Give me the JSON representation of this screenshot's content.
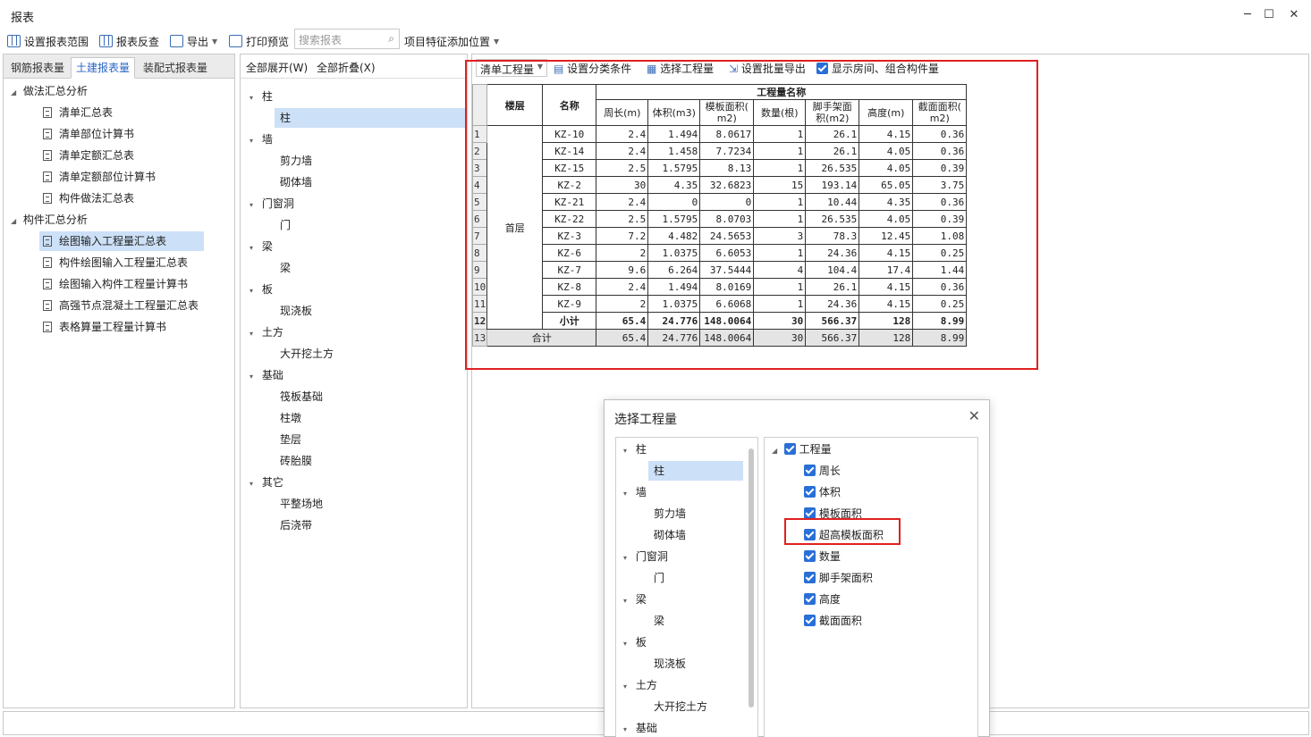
{
  "window": {
    "title": "报表",
    "controls": [
      "─",
      "☐",
      "✕"
    ]
  },
  "toolbar": {
    "set_range": "设置报表范围",
    "reverse": "报表反查",
    "export": "导出",
    "print_preview": "打印预览",
    "search_placeholder": "搜索报表",
    "add_position": "项目特征添加位置"
  },
  "left_tabs": [
    "钢筋报表量",
    "土建报表量",
    "装配式报表量"
  ],
  "left_tree": {
    "group1": "做法汇总分析",
    "group1_items": [
      "清单汇总表",
      "清单部位计算书",
      "清单定额汇总表",
      "清单定额部位计算书",
      "构件做法汇总表"
    ],
    "group2": "构件汇总分析",
    "group2_items": [
      "绘图输入工程量汇总表",
      "构件绘图输入工程量汇总表",
      "绘图输入构件工程量计算书",
      "高强节点混凝土工程量汇总表",
      "表格算量工程量计算书"
    ]
  },
  "mid": {
    "expand_all": "全部展开(W)",
    "collapse_all": "全部折叠(X)",
    "tree": [
      {
        "label": "柱",
        "children": [
          "柱"
        ]
      },
      {
        "label": "墙",
        "children": [
          "剪力墙",
          "砌体墙"
        ]
      },
      {
        "label": "门窗洞",
        "children": [
          "门"
        ]
      },
      {
        "label": "梁",
        "children": [
          "梁"
        ]
      },
      {
        "label": "板",
        "children": [
          "现浇板"
        ]
      },
      {
        "label": "土方",
        "children": [
          "大开挖土方"
        ]
      },
      {
        "label": "基础",
        "children": [
          "筏板基础",
          "柱墩",
          "垫层",
          "砖胎膜"
        ]
      },
      {
        "label": "其它",
        "children": [
          "平整场地",
          "后浇带"
        ]
      }
    ]
  },
  "report_toolbar": {
    "select_value": "清单工程量",
    "set_condition": "设置分类条件",
    "select_qty": "选择工程量",
    "batch_export": "设置批量导出",
    "show_room": "显示房间、组合构件量"
  },
  "report_table": {
    "h_floor": "楼层",
    "h_name": "名称",
    "h_group": "工程量名称",
    "h_cols": [
      "周长(m)",
      "体积(m3)",
      "模板面积(m2)",
      "数量(根)",
      "脚手架面积(m2)",
      "高度(m)",
      "截面面积(m2)"
    ],
    "h_cols_line1": [
      "周长(m)",
      "体积(m3)",
      "模板面积(",
      "数量(根)",
      "脚手架面",
      "高度(m)",
      "截面面积("
    ],
    "h_cols_line2": [
      "",
      "",
      "m2)",
      "",
      "积(m2)",
      "",
      "m2)"
    ],
    "floor": "首层",
    "rows": [
      [
        "KZ-10",
        "2.4",
        "1.494",
        "8.0617",
        "1",
        "26.1",
        "4.15",
        "0.36"
      ],
      [
        "KZ-14",
        "2.4",
        "1.458",
        "7.7234",
        "1",
        "26.1",
        "4.05",
        "0.36"
      ],
      [
        "KZ-15",
        "2.5",
        "1.5795",
        "8.13",
        "1",
        "26.535",
        "4.05",
        "0.39"
      ],
      [
        "KZ-2",
        "30",
        "4.35",
        "32.6823",
        "15",
        "193.14",
        "65.05",
        "3.75"
      ],
      [
        "KZ-21",
        "2.4",
        "0",
        "0",
        "1",
        "10.44",
        "4.35",
        "0.36"
      ],
      [
        "KZ-22",
        "2.5",
        "1.5795",
        "8.0703",
        "1",
        "26.535",
        "4.05",
        "0.39"
      ],
      [
        "KZ-3",
        "7.2",
        "4.482",
        "24.5653",
        "3",
        "78.3",
        "12.45",
        "1.08"
      ],
      [
        "KZ-6",
        "2",
        "1.0375",
        "6.6053",
        "1",
        "24.36",
        "4.15",
        "0.25"
      ],
      [
        "KZ-7",
        "9.6",
        "6.264",
        "37.5444",
        "4",
        "104.4",
        "17.4",
        "1.44"
      ],
      [
        "KZ-8",
        "2.4",
        "1.494",
        "8.0169",
        "1",
        "26.1",
        "4.15",
        "0.36"
      ],
      [
        "KZ-9",
        "2",
        "1.0375",
        "6.6068",
        "1",
        "24.36",
        "4.15",
        "0.25"
      ]
    ],
    "subtotal_label": "小计",
    "subtotal": [
      "65.4",
      "24.776",
      "148.0064",
      "30",
      "566.37",
      "128",
      "8.99"
    ],
    "total_label": "合计",
    "total": [
      "65.4",
      "24.776",
      "148.0064",
      "30",
      "566.37",
      "128",
      "8.99"
    ],
    "row_numbers": [
      "1",
      "2",
      "3",
      "4",
      "5",
      "6",
      "7",
      "8",
      "9",
      "10",
      "11",
      "12",
      "13"
    ]
  },
  "dialog": {
    "title": "选择工程量",
    "tree": [
      {
        "label": "柱",
        "children": [
          "柱"
        ]
      },
      {
        "label": "墙",
        "children": [
          "剪力墙",
          "砌体墙"
        ]
      },
      {
        "label": "门窗洞",
        "children": [
          "门"
        ]
      },
      {
        "label": "梁",
        "children": [
          "梁"
        ]
      },
      {
        "label": "板",
        "children": [
          "现浇板"
        ]
      },
      {
        "label": "土方",
        "children": [
          "大开挖土方"
        ]
      },
      {
        "label": "基础",
        "children": []
      }
    ],
    "qty_root": "工程量",
    "qty_items": [
      "周长",
      "体积",
      "模板面积",
      "超高模板面积",
      "数量",
      "脚手架面积",
      "高度",
      "截面面积"
    ]
  },
  "colors": {
    "accent": "#2a6fd6",
    "highlight_box": "#e02020",
    "selected_bg": "#cce0f7"
  }
}
